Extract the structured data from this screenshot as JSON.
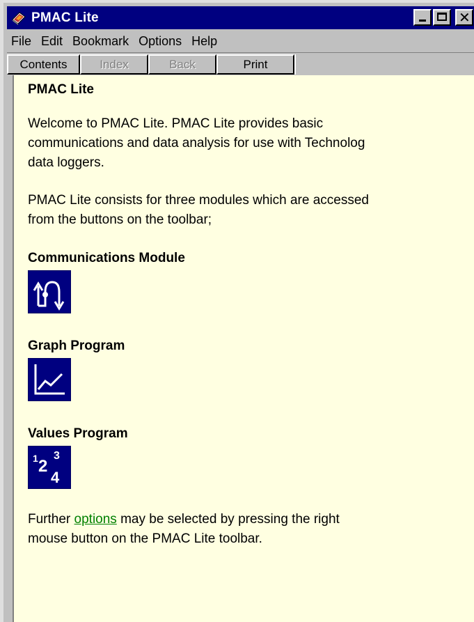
{
  "window": {
    "title": "PMAC Lite",
    "icon": "pmac-app-icon",
    "controls": [
      "minimize",
      "maximize",
      "close"
    ]
  },
  "menu": [
    "File",
    "Edit",
    "Bookmark",
    "Options",
    "Help"
  ],
  "buttons": {
    "contents": "Contents",
    "index": "Index",
    "back": "Back",
    "print": "Print"
  },
  "content": {
    "heading": "PMAC Lite",
    "intro": [
      "Welcome to PMAC Lite.  PMAC Lite provides basic",
      "communications and data analysis for use with Technolog",
      "data loggers."
    ],
    "modules_text": [
      "PMAC Lite consists for three modules which are accessed",
      "from the buttons on the toolbar;"
    ],
    "modules": [
      {
        "name": "Communications Module",
        "icon": "communications-icon"
      },
      {
        "name": "Graph Program",
        "icon": "graph-icon"
      },
      {
        "name": "Values Program",
        "icon": "values-icon",
        "digits": [
          "1",
          "2",
          "3",
          "4"
        ]
      }
    ],
    "further": {
      "before": "Further ",
      "link": "options",
      "after": " may be selected by pressing the right",
      "line2": "mouse button on the PMAC Lite toolbar."
    }
  },
  "colors": {
    "titlebar": "#000080",
    "content_bg": "#ffffe1",
    "link": "#008000",
    "chrome": "#c0c0c0"
  }
}
